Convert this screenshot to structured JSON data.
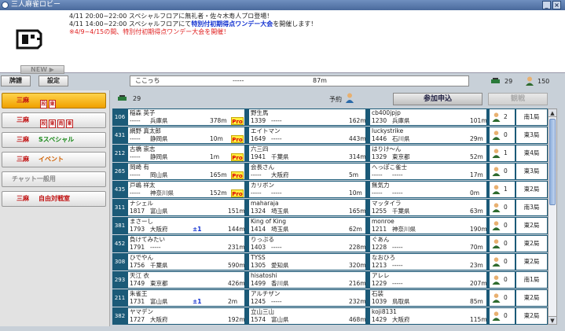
{
  "window": {
    "title": "三人麻雀ロビー"
  },
  "news": {
    "lines": [
      {
        "text": "4/11 20:00~22:00 スペシャルフロアに無礼者・佐々木寿人プロ登場！",
        "style": ""
      },
      {
        "text": "4/11 14:00~22:00 スペシャルフロアにて",
        "suffix": "特別付初期得点ワンデー大会",
        "tail": "を開催します！"
      },
      {
        "text": "※4/9~4/15の間、特別付初期得点ワンデー大会を開催！",
        "style": "red"
      }
    ],
    "new_label": "NEW ▶"
  },
  "tabs": {
    "record": "牌譜",
    "settings": "設定"
  },
  "info": {
    "name": "ここっち",
    "dash": "-----",
    "distance": "87m",
    "online": "29",
    "members": "150"
  },
  "header": {
    "waiting": "29",
    "reserve": "予約",
    "join": "参加申込",
    "watch": "観戦"
  },
  "sidebar": [
    {
      "prefix": "三麻",
      "label": "",
      "tags": [
        "段",
        "東"
      ],
      "active": true
    },
    {
      "prefix": "三麻",
      "label": "",
      "tags": [
        "段",
        "東",
        "南",
        "東"
      ],
      "active": false
    },
    {
      "prefix": "三麻",
      "label": "Sスペシャル",
      "color": "green",
      "active": false
    },
    {
      "prefix": "三麻",
      "label": "イベント",
      "color": "orange",
      "active": false
    },
    {
      "prefix": "",
      "label": "チャット一般用",
      "color": "gray",
      "active": false
    },
    {
      "prefix": "三麻",
      "label": "自由対戦室",
      "color": "red",
      "active": false
    }
  ],
  "rows": [
    {
      "num": "106",
      "players": [
        {
          "name": "稲森 英子",
          "rate": "-----",
          "pref": "兵庫県",
          "dist": "378m",
          "pro": true
        },
        {
          "name": "野生馬",
          "rate": "1339",
          "pref": "-----",
          "dist": "162m",
          "pro": false
        },
        {
          "name": "cb400jpjp",
          "rate": "1230",
          "pref": "兵庫県",
          "dist": "101m",
          "pro": false
        }
      ],
      "count": "2",
      "round": "南1局"
    },
    {
      "num": "431",
      "players": [
        {
          "name": "網野 真太郎",
          "rate": "-----",
          "pref": "静岡県",
          "dist": "10m",
          "pro": true
        },
        {
          "name": "エイトマン",
          "rate": "1649",
          "pref": "-----",
          "dist": "443m",
          "pro": false
        },
        {
          "name": "luckystrike",
          "rate": "1446",
          "pref": "石川県",
          "dist": "29m",
          "pro": false
        }
      ],
      "count": "0",
      "round": "東3局"
    },
    {
      "num": "212",
      "players": [
        {
          "name": "古橋 崇志",
          "rate": "-----",
          "pref": "静岡県",
          "dist": "1m",
          "pro": true
        },
        {
          "name": "六三四",
          "rate": "1941",
          "pref": "千葉県",
          "dist": "314m",
          "pro": false
        },
        {
          "name": "はりけ〜ん",
          "rate": "1329",
          "pref": "東京都",
          "dist": "52m",
          "pro": false
        }
      ],
      "count": "1",
      "round": "東4局"
    },
    {
      "num": "265",
      "players": [
        {
          "name": "岡崎 有",
          "rate": "-----",
          "pref": "岡山県",
          "dist": "165m",
          "pro": true
        },
        {
          "name": "会長さん",
          "rate": "-----",
          "pref": "大阪府",
          "dist": "5m",
          "pro": false
        },
        {
          "name": "へっぽこ雀士",
          "rate": "-----",
          "pref": "-----",
          "dist": "17m",
          "pro": false
        }
      ],
      "count": "0",
      "round": "東3局"
    },
    {
      "num": "435",
      "players": [
        {
          "name": "戸嶋 祥太",
          "rate": "-----",
          "pref": "神奈川県",
          "dist": "152m",
          "pro": true
        },
        {
          "name": "カリボン",
          "rate": "-----",
          "pref": "-----",
          "dist": "10m",
          "pro": false
        },
        {
          "name": "無気力",
          "rate": "-----",
          "pref": "-----",
          "dist": "0m",
          "pro": false
        }
      ],
      "count": "1",
      "round": "東2局"
    },
    {
      "num": "311",
      "players": [
        {
          "name": "ナシェル",
          "rate": "1817",
          "pref": "富山県",
          "dist": "151m",
          "pro": false
        },
        {
          "name": "maharaja",
          "rate": "1324",
          "pref": "埼玉県",
          "dist": "165m",
          "pro": false
        },
        {
          "name": "マッタイラ",
          "rate": "1255",
          "pref": "千葉県",
          "dist": "63m",
          "pro": false
        }
      ],
      "count": "0",
      "round": "南3局"
    },
    {
      "num": "381",
      "players": [
        {
          "name": "まさーし",
          "rate": "1793",
          "pref": "大阪府",
          "dist": "144m",
          "pro": false,
          "badge": "±1"
        },
        {
          "name": "King of King",
          "rate": "1414",
          "pref": "埼玉県",
          "dist": "62m",
          "pro": false
        },
        {
          "name": "monroe",
          "rate": "1211",
          "pref": "神奈川県",
          "dist": "190m",
          "pro": false
        }
      ],
      "count": "0",
      "round": "東2局"
    },
    {
      "num": "452",
      "players": [
        {
          "name": "負けてみたい",
          "rate": "1791",
          "pref": "-----",
          "dist": "231m",
          "pro": false
        },
        {
          "name": "りっぷる",
          "rate": "1403",
          "pref": "-----",
          "dist": "228m",
          "pro": false
        },
        {
          "name": "ぐあん",
          "rate": "1228",
          "pref": "-----",
          "dist": "70m",
          "pro": false
        }
      ],
      "count": "0",
      "round": "東2局"
    },
    {
      "num": "308",
      "players": [
        {
          "name": "ひでやん",
          "rate": "1756",
          "pref": "千葉県",
          "dist": "590m",
          "pro": false
        },
        {
          "name": "TYSS",
          "rate": "1305",
          "pref": "愛知県",
          "dist": "320m",
          "pro": false
        },
        {
          "name": "なおひろ",
          "rate": "1213",
          "pref": "-----",
          "dist": "23m",
          "pro": false
        }
      ],
      "count": "0",
      "round": "東2局"
    },
    {
      "num": "293",
      "players": [
        {
          "name": "天江 衣",
          "rate": "1749",
          "pref": "東京都",
          "dist": "426m",
          "pro": false
        },
        {
          "name": "hisatoshi",
          "rate": "1499",
          "pref": "香川県",
          "dist": "216m",
          "pro": false
        },
        {
          "name": "アレレ",
          "rate": "1229",
          "pref": "-----",
          "dist": "207m",
          "pro": false
        }
      ],
      "count": "0",
      "round": "南1局"
    },
    {
      "num": "211",
      "players": [
        {
          "name": "朱雀王",
          "rate": "1731",
          "pref": "富山県",
          "dist": "2m",
          "pro": false,
          "badge": "±1"
        },
        {
          "name": "アルチザン",
          "rate": "1245",
          "pref": "-----",
          "dist": "232m",
          "pro": false
        },
        {
          "name": "石装",
          "rate": "1039",
          "pref": "鳥取県",
          "dist": "85m",
          "pro": false
        }
      ],
      "count": "0",
      "round": "東2局"
    },
    {
      "num": "382",
      "players": [
        {
          "name": "ヤマデン",
          "rate": "1727",
          "pref": "大阪府",
          "dist": "192m",
          "pro": false
        },
        {
          "name": "立山三山",
          "rate": "1574",
          "pref": "富山県",
          "dist": "468m",
          "pro": false
        },
        {
          "name": "koji8131",
          "rate": "1429",
          "pref": "大阪府",
          "dist": "115m",
          "pro": false
        }
      ],
      "count": "0",
      "round": "東2局"
    }
  ],
  "colors": {
    "row_bg": "#1b5a78",
    "active_tab": "#f0a000",
    "pro_bg": "#ffee40",
    "pro_text": "#dd0000"
  },
  "icons": {
    "waiting": "table-icon",
    "person": "person-icon",
    "close": "close-icon",
    "minimize": "minimize-icon"
  }
}
